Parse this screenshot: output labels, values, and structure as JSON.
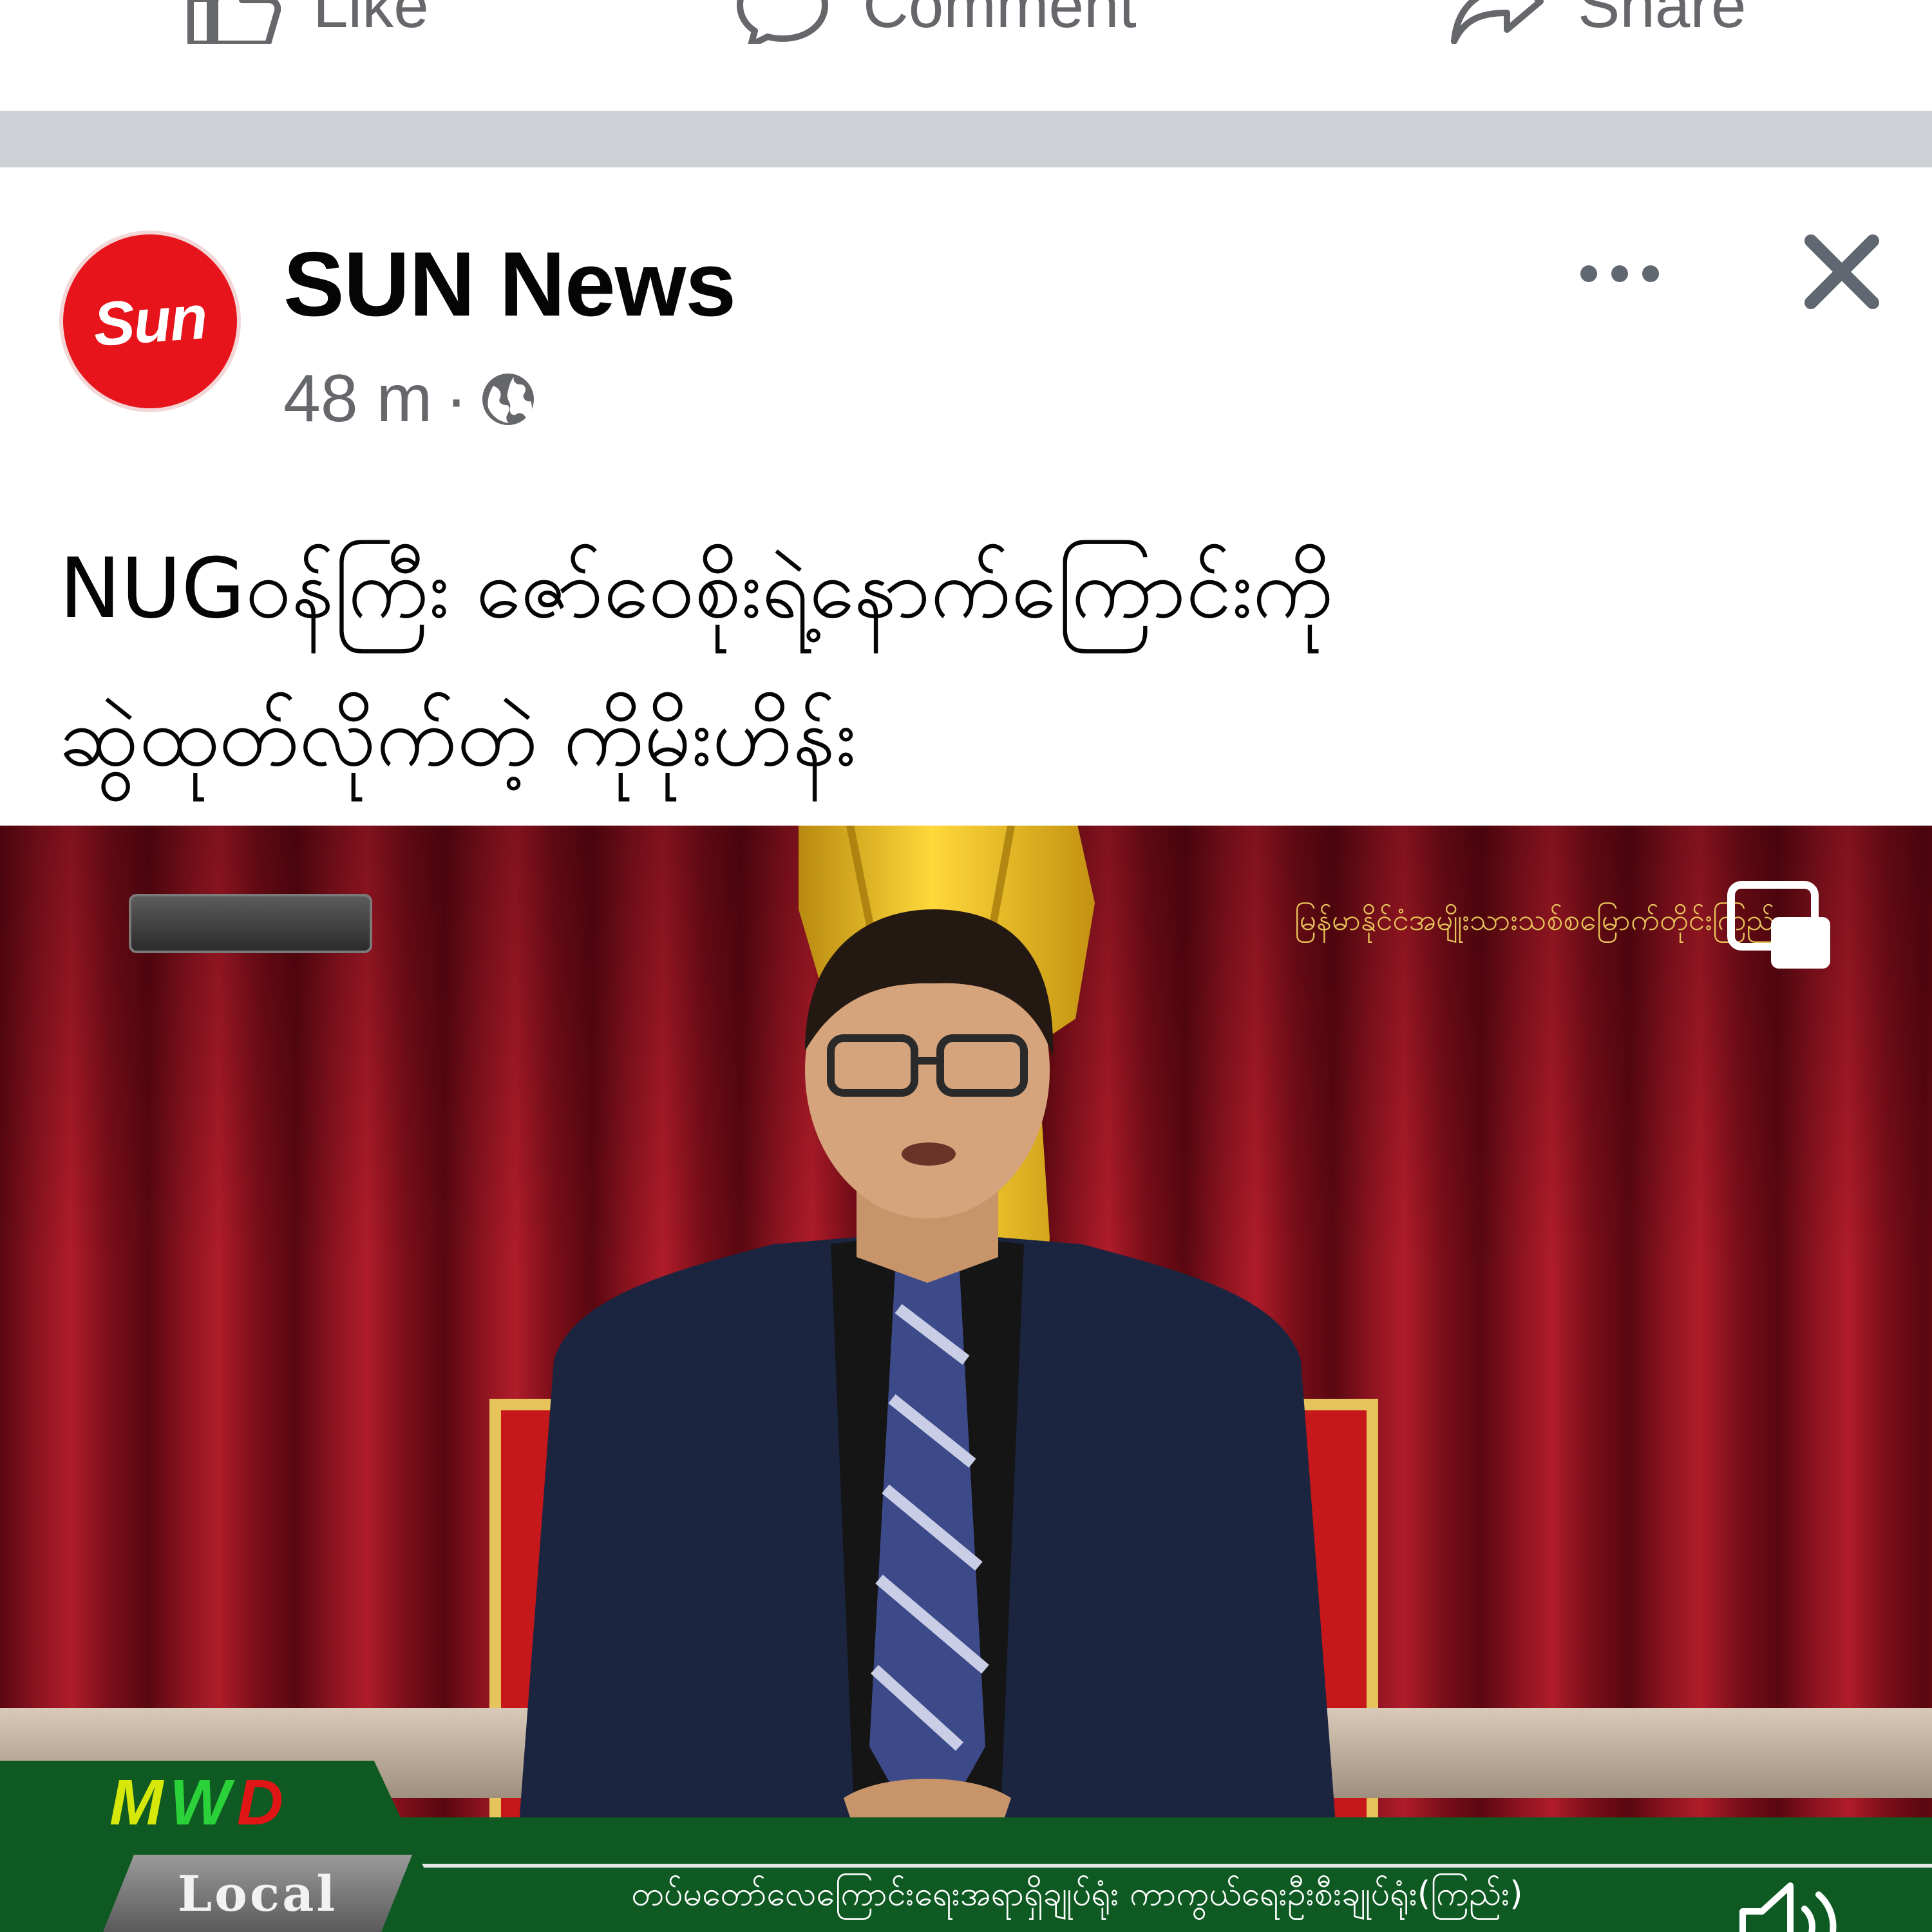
{
  "prev_post_actions": {
    "like": "Like",
    "comment": "Comment",
    "share": "Share"
  },
  "post": {
    "page_name": "SUN News",
    "avatar_text": "Sun",
    "time": "48 m",
    "separator": "·",
    "audience_icon": "globe-icon",
    "caption_line1": "NUGဝန်ကြီး ဇော်ဝေစိုးရဲ့နောက်ကြောင်းကို",
    "caption_line2": "ဆွဲထုတ်လိုက်တဲ့ ကိုမိုးဟိန်း"
  },
  "video": {
    "channel_logo": [
      "M",
      "W",
      "D"
    ],
    "channel_tag": "Local",
    "top_right_caption": "မြန်မာနိုင်ငံအမျိုးသားသစ်စမြောက်တိုင်းကြည်",
    "ticker": "တပ်မတော်လေကြောင်းရေးအရာရှိချုပ်ရုံး ကာကွယ်ရေးဦးစီးချုပ်ရုံး(ကြည်း)"
  },
  "colors": {
    "brand_red": "#e8141c",
    "text_secondary": "#65676b",
    "separator_gray": "#cdd0d4",
    "ticker_green": "#0e5a22"
  }
}
